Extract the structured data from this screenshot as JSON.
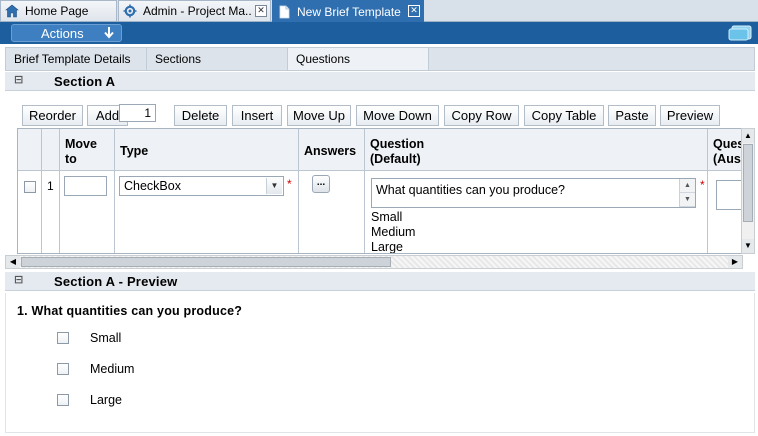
{
  "window_tabs": [
    {
      "label": "Home Page",
      "icon": "home-icon"
    },
    {
      "label": "Admin - Project Ma..",
      "icon": "gear-icon"
    },
    {
      "label": "New Brief Template",
      "icon": "document-icon",
      "active": true
    }
  ],
  "actions": {
    "label": "Actions"
  },
  "content_tabs": [
    {
      "label": "Brief Template Details"
    },
    {
      "label": "Sections"
    },
    {
      "label": "Questions",
      "selected": true
    }
  ],
  "section": {
    "title": "Section A"
  },
  "toolbar": {
    "reorder": "Reorder",
    "add": "Add",
    "row_count": "1",
    "delete": "Delete",
    "insert": "Insert",
    "move_up": "Move Up",
    "move_down": "Move Down",
    "copy_row": "Copy Row",
    "copy_table": "Copy Table",
    "paste": "Paste",
    "preview": "Preview"
  },
  "grid": {
    "columns": {
      "move_to_1": "Move",
      "move_to_2": "to",
      "type": "Type",
      "answers": "Answers",
      "question_default_1": "Question",
      "question_default_2": "(Default)",
      "question_aus_1": "Ques",
      "question_aus_2": "(Aus"
    },
    "rows": [
      {
        "num": "1",
        "move_to": "",
        "type": "CheckBox",
        "answers_button": "...",
        "question": "What quantities can you produce?",
        "answers": [
          "Small",
          "Medium",
          "Large"
        ]
      }
    ]
  },
  "preview": {
    "title": "Section A - Preview",
    "question": "1. What quantities can you produce?",
    "options": [
      "Small",
      "Medium",
      "Large"
    ]
  },
  "colors": {
    "header_blue": "#1d5f9e",
    "active_tab_blue": "#2f6fb0",
    "required_red": "#d00000"
  }
}
